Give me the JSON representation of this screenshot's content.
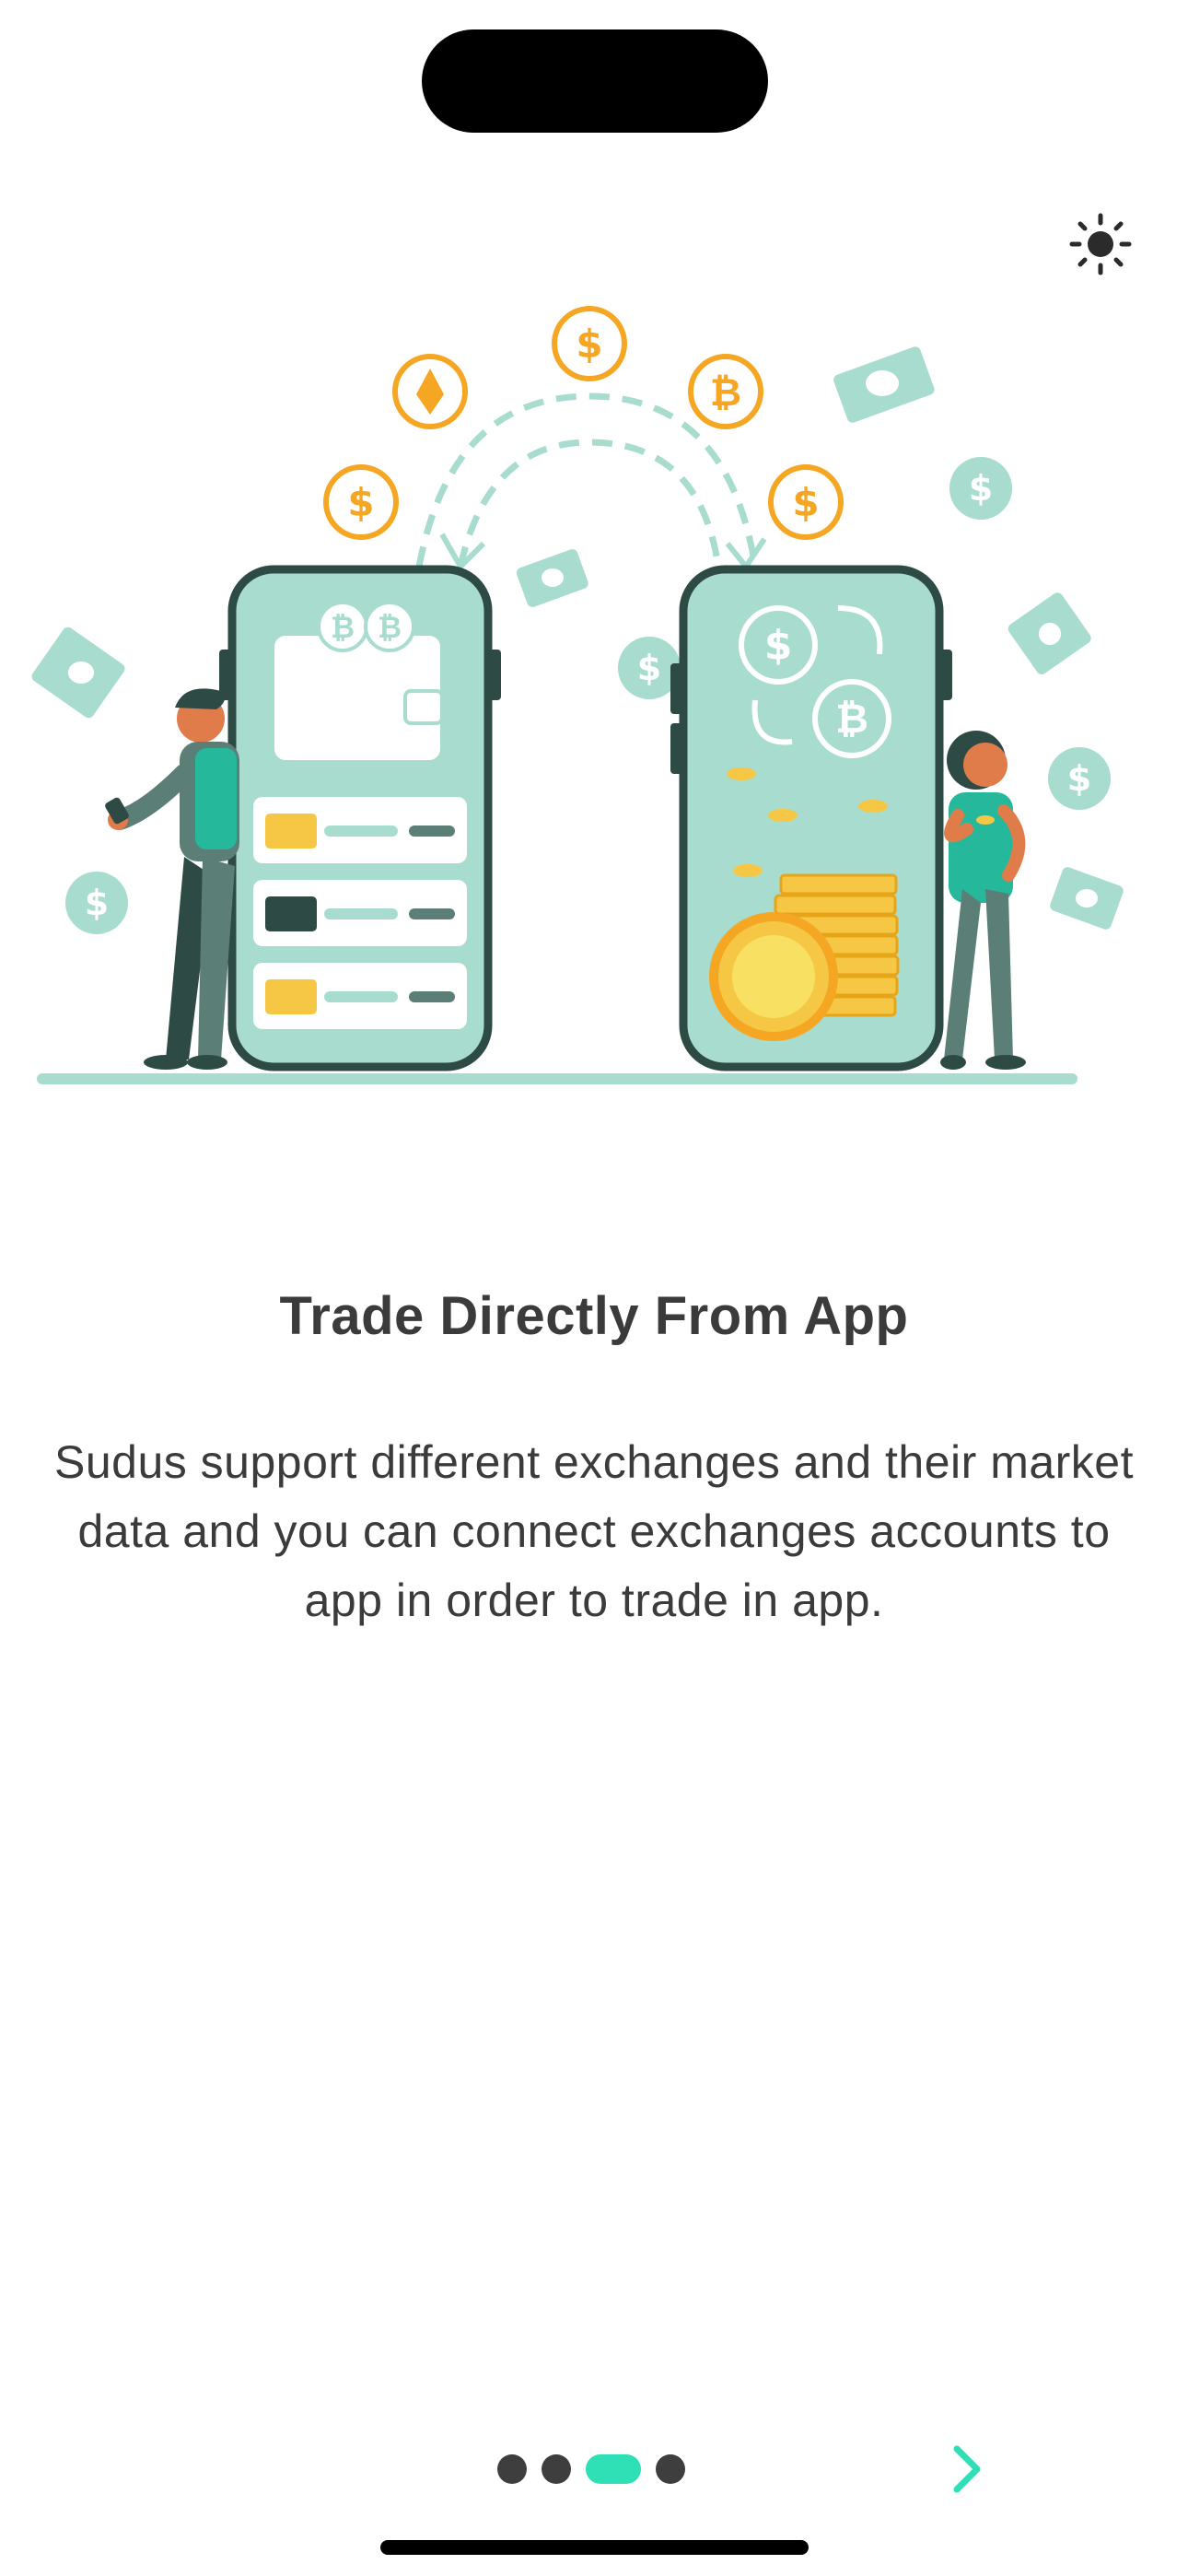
{
  "header": {
    "theme_toggle_icon": "sun-icon"
  },
  "illustration": {
    "name": "trade-illustration",
    "colors": {
      "teal_light": "#a8dccf",
      "dark": "#2e4a45",
      "coin": "#f5a623",
      "gold": "#f6c744"
    }
  },
  "onboarding": {
    "title": "Trade Directly From App",
    "description": "Sudus support different exchanges and their market data and you can connect exchanges accounts to app in order to trade in app."
  },
  "pager": {
    "total": 4,
    "current": 3,
    "active_color": "#2fe0b6"
  },
  "next_button": {
    "icon": "chevron-right-icon",
    "color": "#2fe0b6"
  }
}
